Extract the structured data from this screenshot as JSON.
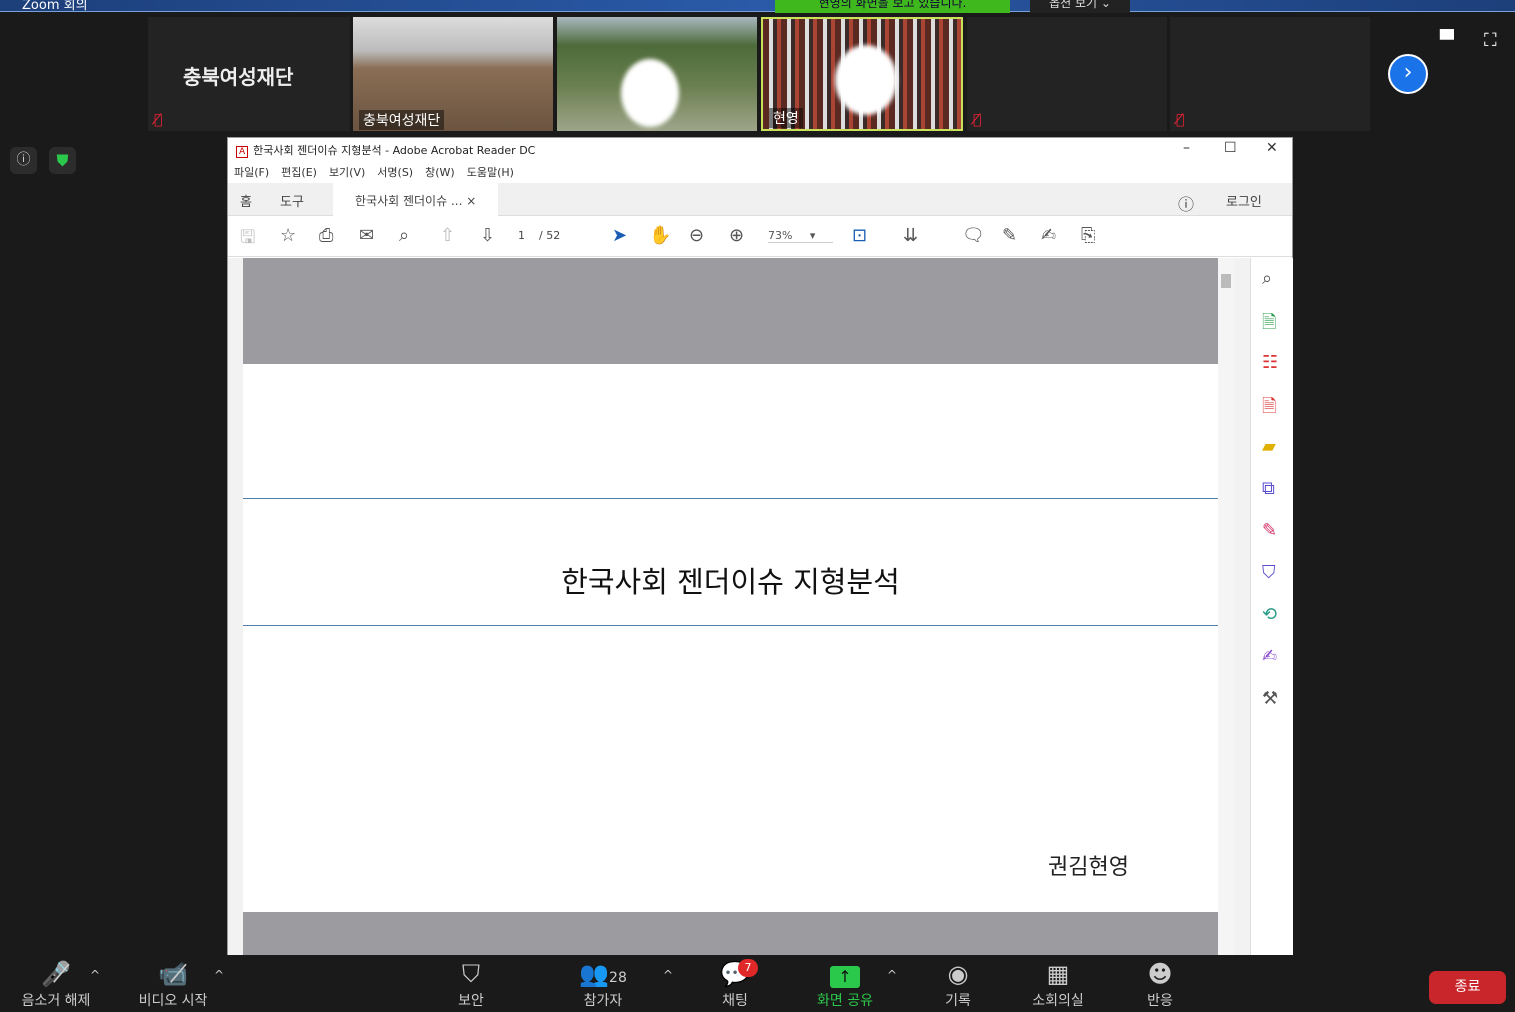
{
  "window": {
    "app_title": "Zoom 회의",
    "banner": "현영의 화면을 보고 있습니다.",
    "view_options": "옵션 보기 ⌄"
  },
  "participants": [
    {
      "name": "충북여성재단",
      "video": false,
      "muted": true
    },
    {
      "name": "충북여성재단",
      "video": true,
      "muted": true
    },
    {
      "name": "",
      "video": true,
      "muted": true
    },
    {
      "name": "현영",
      "video": true,
      "muted": false,
      "active": true
    },
    {
      "name": "",
      "video": false,
      "muted": true
    },
    {
      "name": "",
      "video": false,
      "muted": true
    }
  ],
  "acrobat": {
    "title": "한국사회 젠더이슈 지형분석 - Adobe Acrobat Reader DC",
    "menu": [
      "파일(F)",
      "편집(E)",
      "보기(V)",
      "서명(S)",
      "창(W)",
      "도움말(H)"
    ],
    "tabs": {
      "home": "홈",
      "tools": "도구",
      "doc": "한국사회 젠더이슈 ...",
      "close": "×",
      "login": "로그인"
    },
    "page_current": "1",
    "page_total": "/ 52",
    "zoom": "73%",
    "document": {
      "title": "한국사회 젠더이슈 지형분석",
      "author": "권김현영"
    }
  },
  "toolbar": {
    "mute": "음소거 해제",
    "video": "비디오 시작",
    "security": "보안",
    "participants": "참가자",
    "participant_count": "28",
    "chat": "채팅",
    "chat_badge": "7",
    "share": "화면 공유",
    "record": "기록",
    "breakout": "소회의실",
    "reactions": "반응",
    "end": "종료"
  },
  "colors": {
    "share": "#2bc94b",
    "end": "#c8262b",
    "accent": "#1a73e8"
  }
}
